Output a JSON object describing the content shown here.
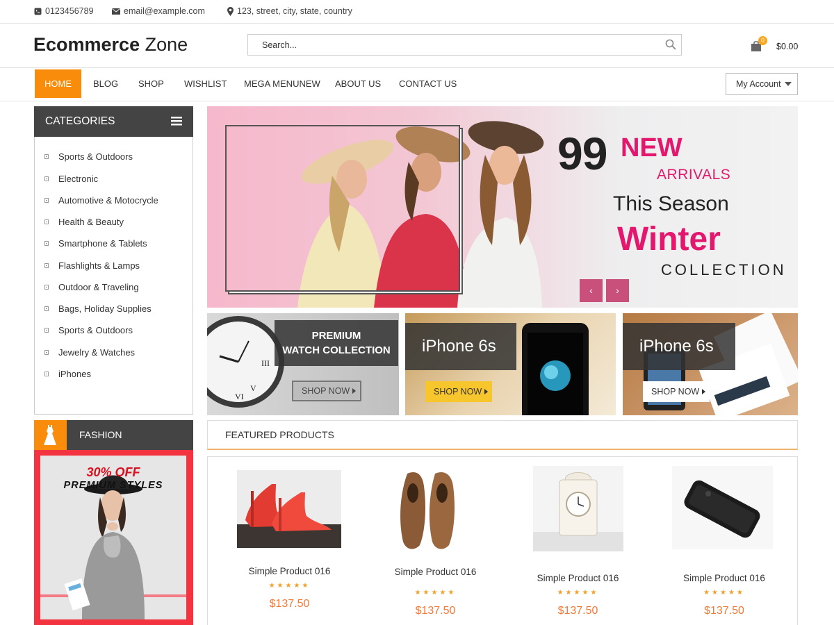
{
  "topbar": {
    "phone": "0123456789",
    "email": "email@example.com",
    "address": "123, street, city, state, country"
  },
  "header": {
    "logo_bold": "Ecommerce",
    "logo_light": "Zone",
    "search_placeholder": "Search...",
    "cart_count": "0",
    "cart_total": "$0.00"
  },
  "nav": {
    "items": [
      {
        "label": "HOME",
        "active": true
      },
      {
        "label": "BLOG"
      },
      {
        "label": "SHOP"
      },
      {
        "label": "WISHLIST"
      },
      {
        "label": "MEGA MENUNEW"
      },
      {
        "label": "ABOUT US"
      },
      {
        "label": "CONTACT US"
      }
    ],
    "account_label": "My Account"
  },
  "sidebar": {
    "categories_title": "CATEGORIES",
    "categories": [
      "Sports & Outdoors",
      "Electronic",
      "Automotive & Motocrycle",
      "Health & Beauty",
      "Smartphone & Tablets",
      "Flashlights & Lamps",
      "Outdoor & Traveling",
      "Bags, Holiday Supplies",
      "Sports & Outdoors",
      "Jewelry & Watches",
      "iPhones"
    ],
    "fashion_title": "FASHION",
    "fashion_ad_line1": "30% OFF",
    "fashion_ad_line2": "PREMIUM STYLES"
  },
  "hero": {
    "num": "99",
    "new": "NEW",
    "arrivals": "ARRIVALS",
    "season": "This Season",
    "winter": "Winter",
    "collection": "COLLECTION",
    "prev": "‹",
    "next": "›"
  },
  "promos": [
    {
      "title_line1": "PREMIUM",
      "title_line2": "WATCH COLLECTION",
      "button": "SHOP NOW"
    },
    {
      "title": "iPhone 6s",
      "button": "SHOP NOW"
    },
    {
      "title": "iPhone 6s",
      "button": "SHOP NOW"
    }
  ],
  "featured": {
    "title": "FEATURED PRODUCTS",
    "products": [
      {
        "name": "Simple Product 016",
        "price": "$137.50",
        "rating": 5,
        "stars": "★★★★★",
        "image": "red-heels"
      },
      {
        "name": "Simple Product 016",
        "price": "$137.50",
        "rating": 5,
        "stars": "★★★★★",
        "image": "brown-shoes"
      },
      {
        "name": "Simple Product 016",
        "price": "$137.50",
        "rating": 5,
        "stars": "★★★★★",
        "image": "clock"
      },
      {
        "name": "Simple Product 016",
        "price": "$137.50",
        "rating": 5,
        "stars": "★★★★★",
        "image": "black-phone"
      }
    ]
  },
  "colors": {
    "accent": "#f98c0a",
    "dark_header": "#444444",
    "price": "#f07a3a",
    "hero_pink": "#e3176d"
  }
}
